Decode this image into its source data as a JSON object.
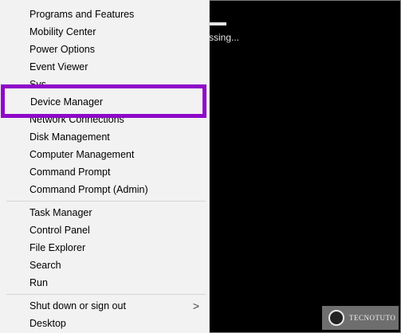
{
  "console": {
    "text": "ssing..."
  },
  "menu": {
    "group1": [
      {
        "label": "Programs and Features"
      },
      {
        "label": "Mobility Center"
      },
      {
        "label": "Power Options"
      },
      {
        "label": "Event Viewer"
      },
      {
        "label": "Sys"
      }
    ],
    "highlighted": {
      "label": "Device Manager"
    },
    "group1b": [
      {
        "label": "Network Connections"
      },
      {
        "label": "Disk Management"
      },
      {
        "label": "Computer Management"
      },
      {
        "label": "Command Prompt"
      },
      {
        "label": "Command Prompt (Admin)"
      }
    ],
    "group2": [
      {
        "label": "Task Manager"
      },
      {
        "label": "Control Panel"
      },
      {
        "label": "File Explorer"
      },
      {
        "label": "Search"
      },
      {
        "label": "Run"
      }
    ],
    "group3": [
      {
        "label": "Shut down or sign out",
        "chevron": ">"
      },
      {
        "label": "Desktop"
      }
    ]
  },
  "colors": {
    "highlight_border": "#8f08c9",
    "menu_bg": "#f2f2f2",
    "desktop_bg": "#000000"
  },
  "watermark": {
    "text": "TECNOTUTO"
  }
}
